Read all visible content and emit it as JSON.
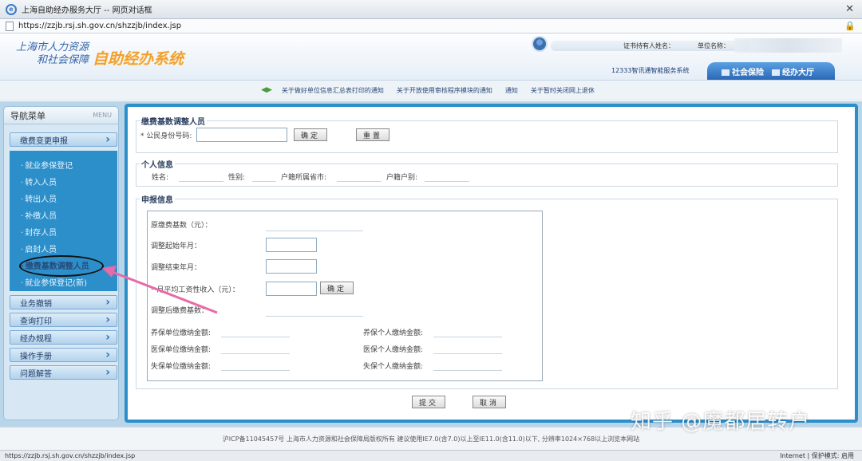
{
  "window": {
    "title": "上海自助经办服务大厅 -- 网页对话框",
    "url": "https://zzjb.rsj.sh.gov.cn/shzzjb/index.jsp"
  },
  "header": {
    "logo_line1": "上海市人力资源",
    "logo_line2": "和社会保障",
    "system_name": "自助经办系统",
    "cert_holder_label": "证书持有人姓名：",
    "org_name_label": "单位名称：",
    "service_link": "12333智讯通智能服务系统",
    "tabs": [
      "社会保险",
      "经办大厅"
    ]
  },
  "notices": [
    "关于做好单位信息汇总表打印的通知",
    "关于开放使用审核程序模块的通知",
    "通知",
    "关于暂时关闭网上退休"
  ],
  "sidebar": {
    "title": "导航菜单",
    "title_en": "MENU",
    "groups_top": "缴费变更申报",
    "subitems": [
      "就业参保登记",
      "转入人员",
      "转出人员",
      "补缴人员",
      "封存人员",
      "启封人员",
      "缴费基数调整人员",
      "就业参保登记(新)"
    ],
    "active_index": 6,
    "groups_bottom": [
      "业务撤销",
      "查询打印",
      "经办规程",
      "操作手册",
      "问题解答"
    ]
  },
  "form": {
    "section1_title": "缴费基数调整人员",
    "id_label": "* 公民身份号码:",
    "confirm_button": "确定",
    "reset_button": "重置",
    "section2_title": "个人信息",
    "name_label": "姓名:",
    "gender_label": "性别:",
    "province_label": "户籍所属省市:",
    "hukou_label": "户籍户别:",
    "section3_title": "申报信息",
    "orig_base_label": "原缴费基数（元）：",
    "start_label": "调整起始年月：",
    "end_label": "调整结束年月：",
    "income_label": "* 月平均工资性收入（元）：",
    "income_confirm": "确定",
    "adjusted_base_label": "调整后缴费基数：",
    "pension_unit_label": "养保单位缴纳金额:",
    "pension_personal_label": "养保个人缴纳金额:",
    "medical_unit_label": "医保单位缴纳金额:",
    "medical_personal_label": "医保个人缴纳金额:",
    "unemp_unit_label": "失保单位缴纳金额:",
    "unemp_personal_label": "失保个人缴纳金额:",
    "submit_button": "提交",
    "cancel_button": "取消"
  },
  "footer": {
    "text": "沪ICP备11045457号  上海市人力资源和社会保障局版权所有  建议使用IE7.0(含7.0)以上至IE11.0(含11.0)以下, 分辨率1024×768以上浏览本网站"
  },
  "status": {
    "url": "https://zzjb.rsj.sh.gov.cn/shzzjb/index.jsp",
    "zone": "Internet | 保护模式: 启用"
  },
  "watermark": "知乎 @魔都居转户",
  "colors": {
    "accent": "#2c8fca",
    "annotation": "#e86aa6"
  }
}
